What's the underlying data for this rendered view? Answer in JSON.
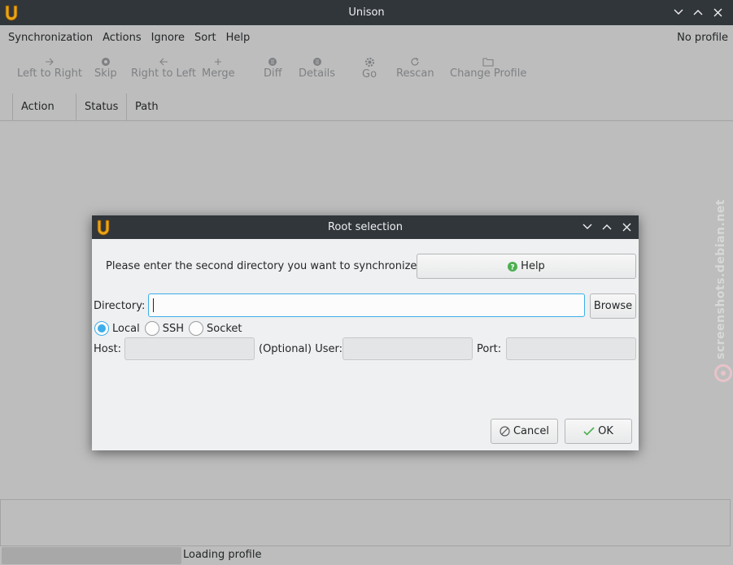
{
  "window": {
    "title": "Unison"
  },
  "menu": {
    "items": [
      "Synchronization",
      "Actions",
      "Ignore",
      "Sort",
      "Help"
    ],
    "profile": "No profile"
  },
  "toolbar": {
    "left_to_right": "Left to Right",
    "skip": "Skip",
    "right_to_left": "Right to Left",
    "merge": "Merge",
    "diff": "Diff",
    "details": "Details",
    "go": "Go",
    "rescan": "Rescan",
    "change_profile": "Change Profile"
  },
  "columns": [
    "Action",
    "Status",
    "Path"
  ],
  "status": {
    "text": "Loading profile"
  },
  "watermark": {
    "text": "screenshots.debian.net"
  },
  "dialog": {
    "title": "Root selection",
    "prompt": "Please enter the second directory you want to synchronize.",
    "help_label": "Help",
    "directory_label": "Directory:",
    "directory_value": "",
    "browse_label": "Browse",
    "connection_types": [
      "Local",
      "SSH",
      "Socket"
    ],
    "selected_connection": "Local",
    "host_label": "Host:",
    "user_label": "(Optional) User:",
    "port_label": "Port:",
    "cancel_label": "Cancel",
    "ok_label": "OK"
  },
  "colors": {
    "titlebar": "#31363b",
    "accent": "#3daee9",
    "help_icon": "#4caf50",
    "ok_check": "#4caf50"
  }
}
